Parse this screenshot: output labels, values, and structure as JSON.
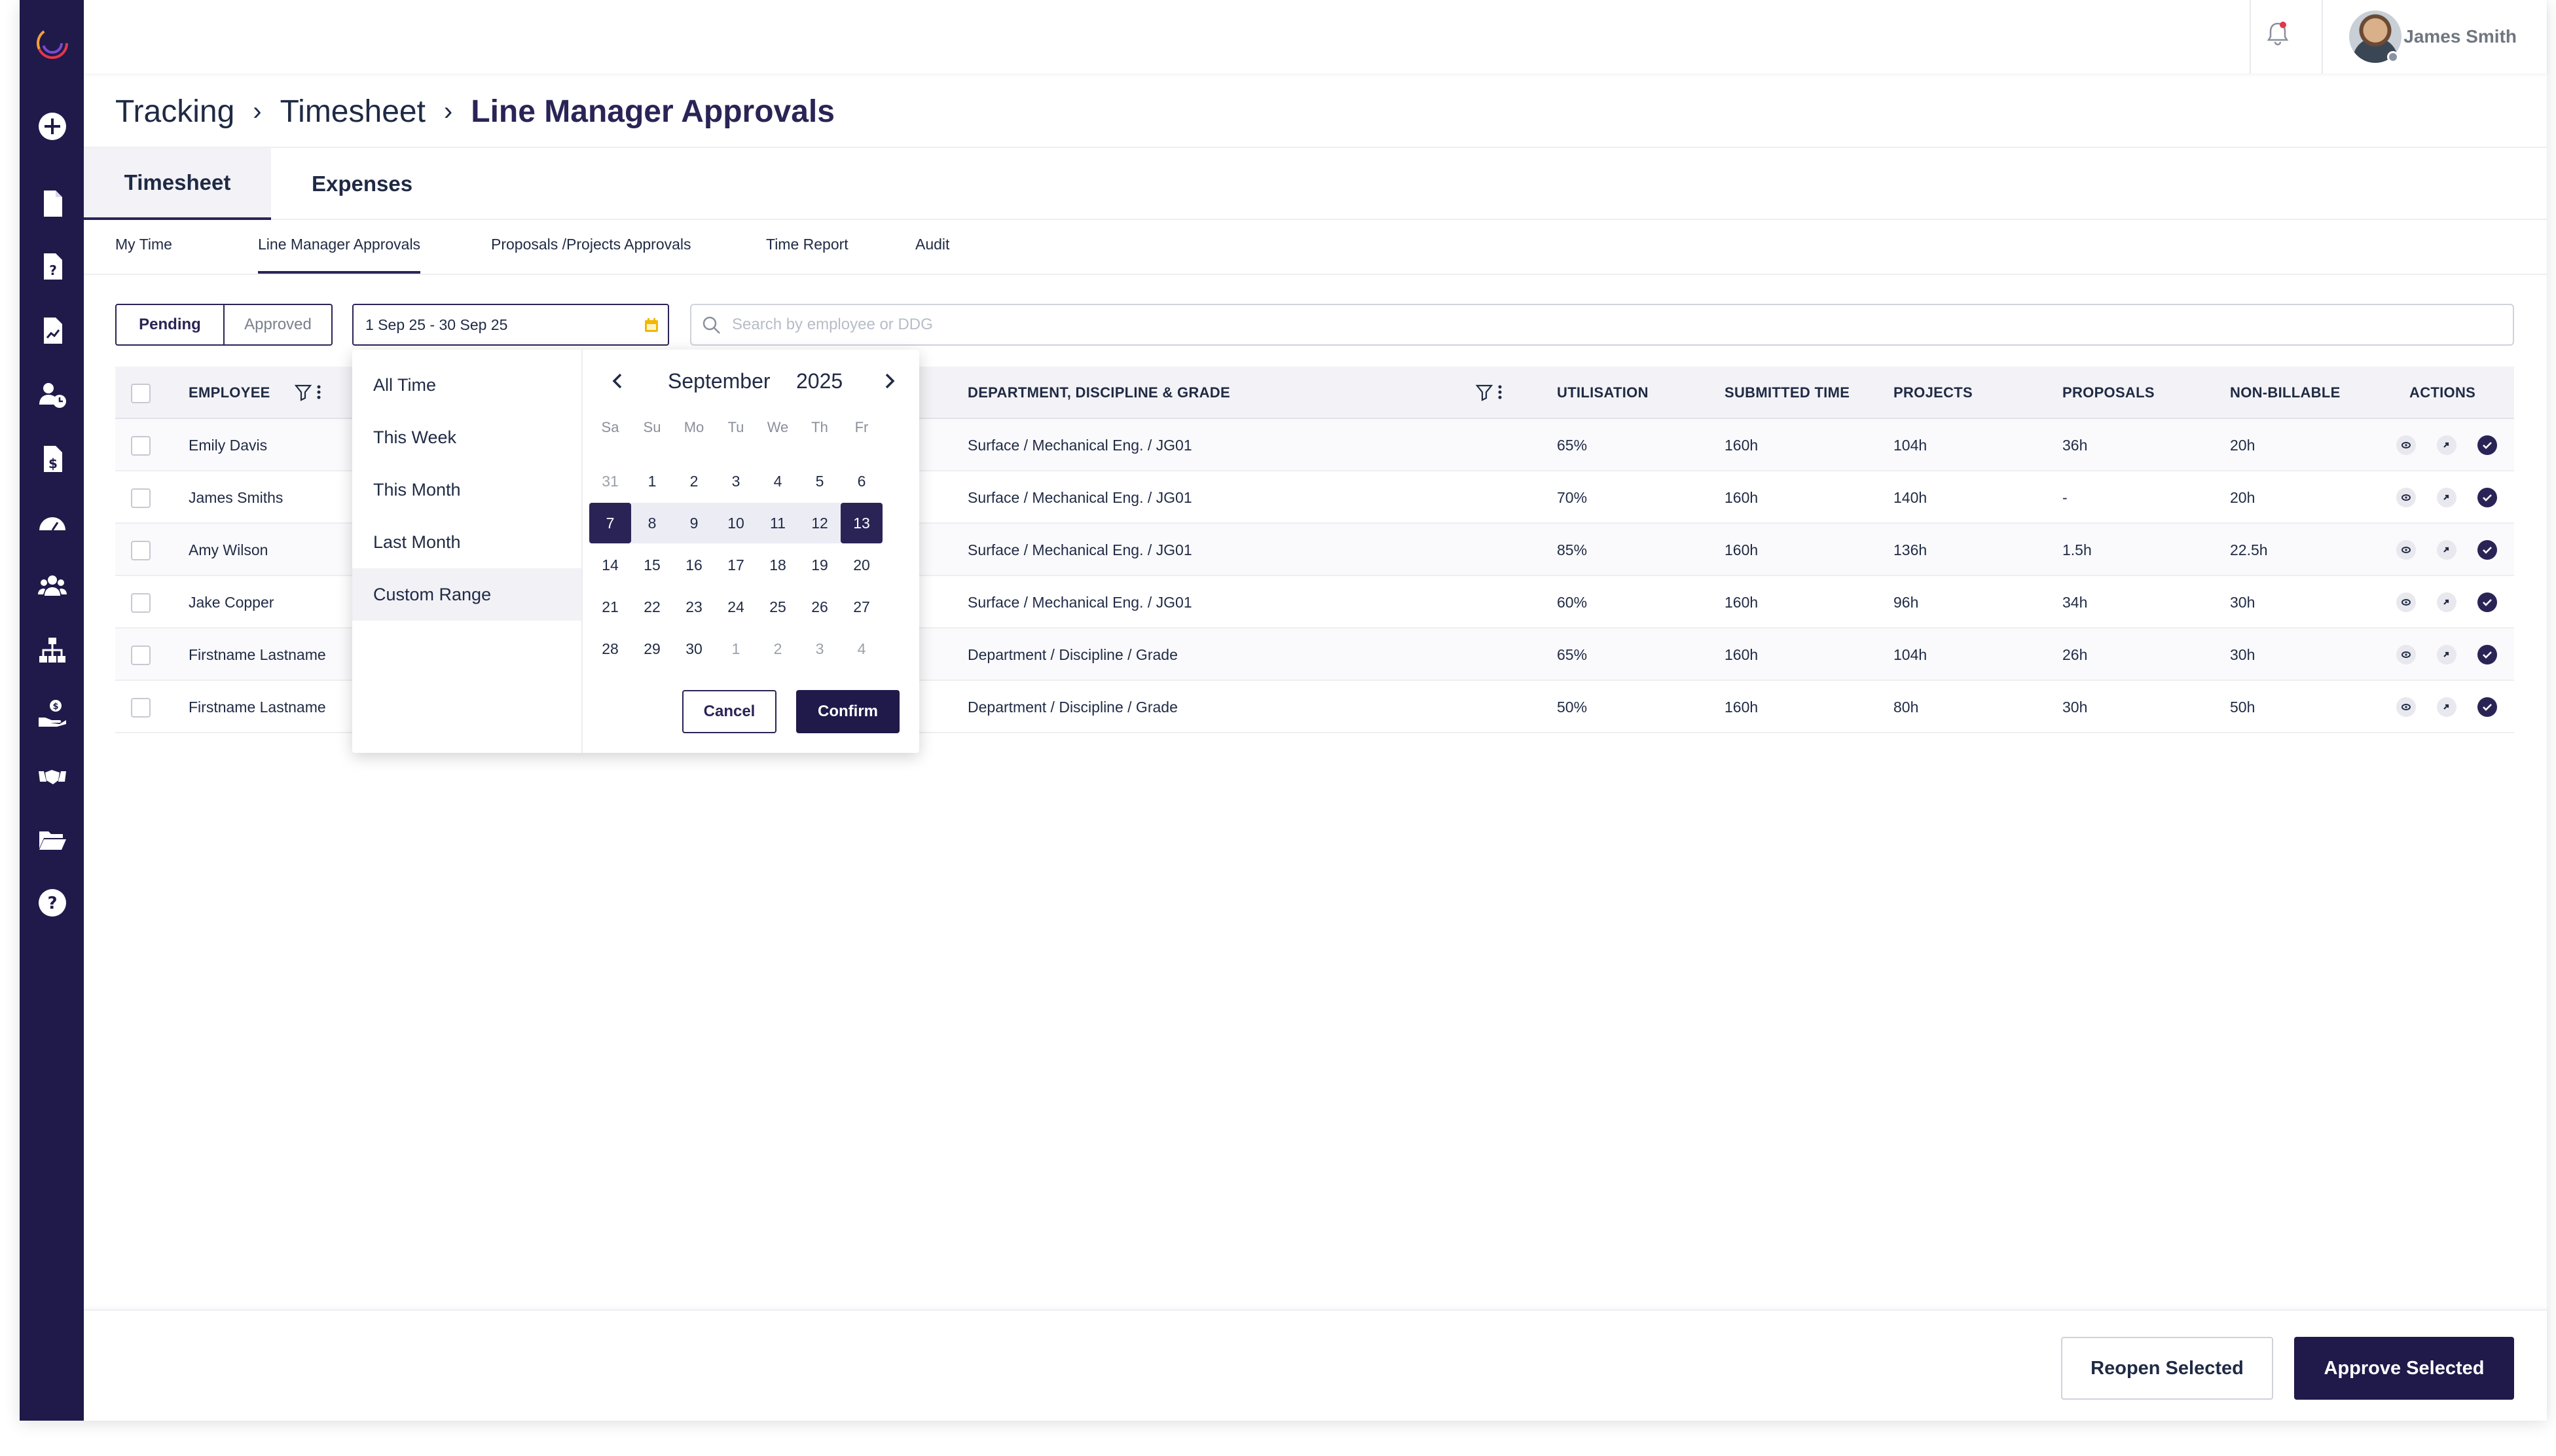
{
  "topbar": {
    "user_name": "James Smith"
  },
  "breadcrumb": {
    "level1": "Tracking",
    "level2": "Timesheet",
    "current": "Line Manager Approvals",
    "separator": "›"
  },
  "main_tabs": [
    {
      "label": "Timesheet",
      "active": true
    },
    {
      "label": "Expenses",
      "active": false
    }
  ],
  "sub_tabs": [
    {
      "label": "My Time"
    },
    {
      "label": "Line Manager Approvals",
      "active": true
    },
    {
      "label": "Proposals /Projects Approvals"
    },
    {
      "label": "Time Report"
    },
    {
      "label": "Audit"
    }
  ],
  "status_toggle": {
    "pending": "Pending",
    "approved": "Approved",
    "selected": "Pending"
  },
  "date_filter": {
    "value": "1 Sep 25 - 30 Sep 25"
  },
  "search": {
    "placeholder": "Search by employee or DDG"
  },
  "table": {
    "headers": {
      "employee": "EMPLOYEE",
      "ddg": "DEPARTMENT, DISCIPLINE & GRADE",
      "utilisation": "UTILISATION",
      "submitted": "SUBMITTED TIME",
      "projects": "PROJECTS",
      "proposals": "PROPOSALS",
      "nonbillable": "NON-BILLABLE",
      "actions": "ACTIONS"
    },
    "rows": [
      {
        "employee": "Emily Davis",
        "ddg": "Surface / Mechanical Eng. / JG01",
        "utilisation": "65%",
        "submitted": "160h",
        "projects": "104h",
        "proposals": "36h",
        "nonbillable": "20h"
      },
      {
        "employee": "James Smiths",
        "ddg": "Surface / Mechanical Eng. / JG01",
        "utilisation": "70%",
        "submitted": "160h",
        "projects": "140h",
        "proposals": "-",
        "nonbillable": "20h"
      },
      {
        "employee": "Amy Wilson",
        "ddg": "Surface / Mechanical Eng. / JG01",
        "utilisation": "85%",
        "submitted": "160h",
        "projects": "136h",
        "proposals": "1.5h",
        "nonbillable": "22.5h"
      },
      {
        "employee": "Jake Copper",
        "ddg": "Surface / Mechanical Eng. / JG01",
        "utilisation": "60%",
        "submitted": "160h",
        "projects": "96h",
        "proposals": "34h",
        "nonbillable": "30h"
      },
      {
        "employee": "Firstname Lastname",
        "ddg": "Department / Discipline / Grade",
        "utilisation": "65%",
        "submitted": "160h",
        "projects": "104h",
        "proposals": "26h",
        "nonbillable": "30h"
      },
      {
        "employee": "Firstname Lastname",
        "ddg": "Department / Discipline / Grade",
        "utilisation": "50%",
        "submitted": "160h",
        "projects": "80h",
        "proposals": "30h",
        "nonbillable": "50h"
      }
    ]
  },
  "date_dropdown": {
    "presets": [
      {
        "label": "All Time"
      },
      {
        "label": "This Week"
      },
      {
        "label": "This Month"
      },
      {
        "label": "Last Month"
      },
      {
        "label": "Custom Range",
        "active": true
      }
    ],
    "calendar": {
      "month": "September",
      "year": "2025",
      "weekdays": [
        "Sa",
        "Su",
        "Mo",
        "Tu",
        "We",
        "Th",
        "Fr"
      ],
      "weeks": [
        [
          "31",
          "1",
          "2",
          "3",
          "4",
          "5",
          "6"
        ],
        [
          "7",
          "8",
          "9",
          "10",
          "11",
          "12",
          "13"
        ],
        [
          "14",
          "15",
          "16",
          "17",
          "18",
          "19",
          "20"
        ],
        [
          "21",
          "22",
          "23",
          "24",
          "25",
          "26",
          "27"
        ],
        [
          "28",
          "29",
          "30",
          "1",
          "2",
          "3",
          "4"
        ]
      ],
      "range_start": "7",
      "range_end": "13"
    },
    "cancel_label": "Cancel",
    "confirm_label": "Confirm"
  },
  "footer": {
    "reopen_label": "Reopen Selected",
    "approve_label": "Approve Selected"
  },
  "colors": {
    "brand_dark": "#1f1a4a",
    "accent": "#2a2456",
    "notification": "#e0384d",
    "calendar_icon": "#f2b705"
  }
}
